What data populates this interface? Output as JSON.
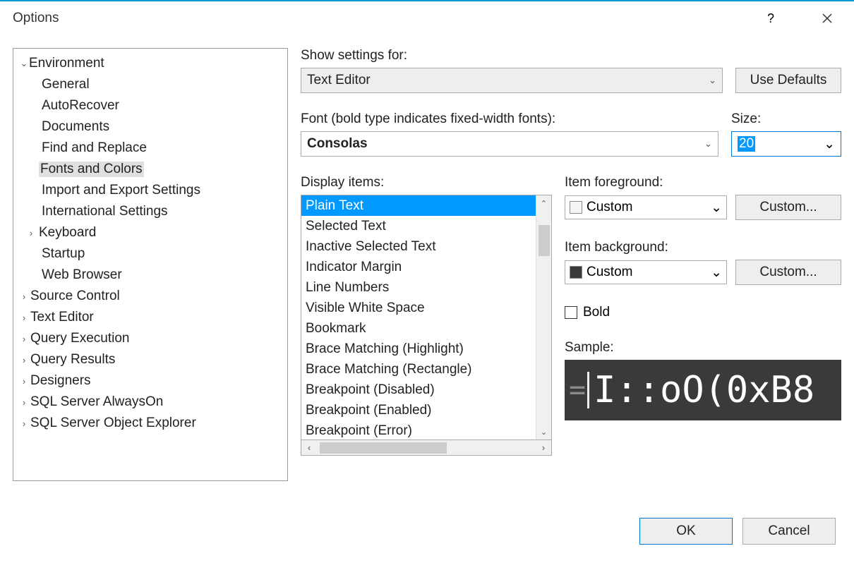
{
  "title": "Options",
  "tree": {
    "root": "Environment",
    "children": [
      "General",
      "AutoRecover",
      "Documents",
      "Find and Replace",
      "Fonts and Colors",
      "Import and Export Settings",
      "International Settings",
      "Keyboard",
      "Startup",
      "Web Browser"
    ],
    "selected": "Fonts and Colors",
    "sections": [
      "Source Control",
      "Text Editor",
      "Query Execution",
      "Query Results",
      "Designers",
      "SQL Server AlwaysOn",
      "SQL Server Object Explorer"
    ]
  },
  "settings": {
    "show_for_label": "Show settings for:",
    "show_for_value": "Text Editor",
    "use_defaults": "Use Defaults",
    "font_label": "Font (bold type indicates fixed-width fonts):",
    "font_value": "Consolas",
    "size_label": "Size:",
    "size_value": "20",
    "display_items_label": "Display items:",
    "display_items": [
      "Plain Text",
      "Selected Text",
      "Inactive Selected Text",
      "Indicator Margin",
      "Line Numbers",
      "Visible White Space",
      "Bookmark",
      "Brace Matching (Highlight)",
      "Brace Matching (Rectangle)",
      "Breakpoint (Disabled)",
      "Breakpoint (Enabled)",
      "Breakpoint (Error)"
    ],
    "display_selected": "Plain Text",
    "fg_label": "Item foreground:",
    "fg_value": "Custom",
    "fg_swatch": "#f5f5f5",
    "bg_label": "Item background:",
    "bg_value": "Custom",
    "bg_swatch": "#3a3a3a",
    "custom_btn": "Custom...",
    "bold_label": "Bold",
    "sample_label": "Sample:",
    "sample_text": "I::oO(0xB8"
  },
  "footer": {
    "ok": "OK",
    "cancel": "Cancel"
  }
}
